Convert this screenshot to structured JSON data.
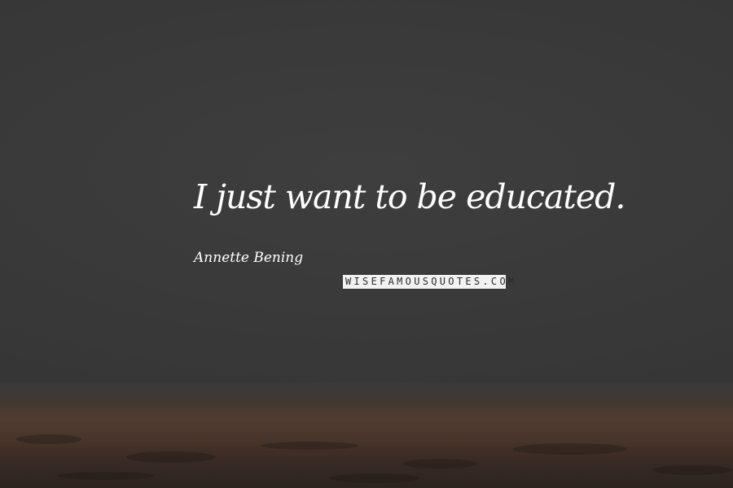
{
  "quote": {
    "text": "I just want to be educated.",
    "author": "Annette Bening"
  },
  "watermark": {
    "text": "WISEFAMOUSQUOTES.COM"
  },
  "colors": {
    "background": "#3a3a3a",
    "ground": "#503c30",
    "text": "#ffffff",
    "watermark_bg": "#f2f2f2",
    "watermark_text": "#2b2b2b"
  }
}
